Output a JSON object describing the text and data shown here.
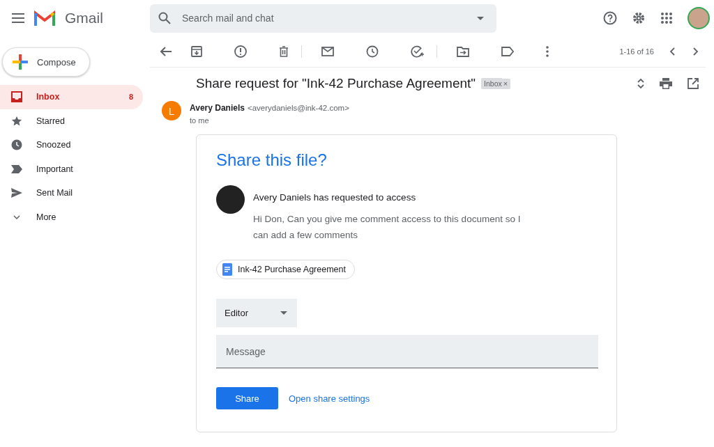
{
  "header": {
    "app_name": "Gmail",
    "search": {
      "placeholder": "Search mail and chat"
    }
  },
  "sidebar": {
    "compose": "Compose",
    "items": [
      {
        "label": "Inbox",
        "count": "8",
        "selected": true
      },
      {
        "label": "Starred",
        "selected": false
      },
      {
        "label": "Snoozed",
        "selected": false
      },
      {
        "label": "Important",
        "selected": false
      },
      {
        "label": "Sent Mail",
        "selected": false
      },
      {
        "label": "More",
        "selected": false
      }
    ]
  },
  "toolbar": {
    "pagination": "1-16 of 16"
  },
  "message": {
    "subject": "Share request for \"Ink-42 Purchase Agreement\"",
    "label": "Inbox",
    "label_close": "×",
    "sender_initial": "L",
    "sender_name": "Avery Daniels",
    "sender_email": "<averydaniels@ink-42.com>",
    "recipient": "to me",
    "card": {
      "title": "Share this file?",
      "requester": "Avery Daniels has requested to access",
      "note": "Hi Don, Can you give me comment access to this document so I can add a few comments",
      "file": "Ink-42 Purchase Agreement",
      "role": "Editor",
      "message": {
        "placeholder": "Message"
      },
      "share_button": "Share",
      "settings_link": "Open share settings"
    }
  }
}
